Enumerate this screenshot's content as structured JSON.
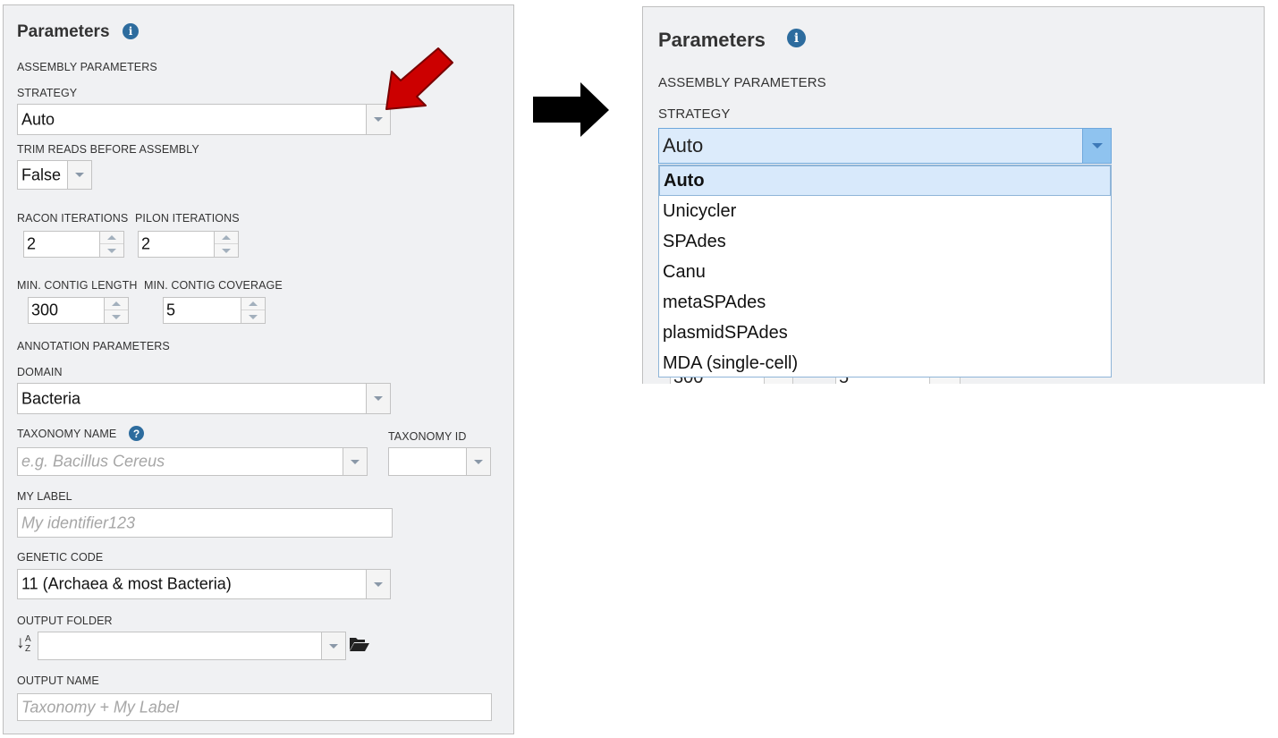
{
  "left": {
    "title": "Parameters",
    "assembly_section": "ASSEMBLY PARAMETERS",
    "strategy_label": "STRATEGY",
    "strategy_value": "Auto",
    "trim_label": "TRIM READS BEFORE ASSEMBLY",
    "trim_value": "False",
    "racon_label": "RACON ITERATIONS",
    "racon_value": "2",
    "pilon_label": "PILON ITERATIONS",
    "pilon_value": "2",
    "min_len_label": "MIN. CONTIG LENGTH",
    "min_len_value": "300",
    "min_cov_label": "MIN. CONTIG COVERAGE",
    "min_cov_value": "5",
    "annotation_section": "ANNOTATION PARAMETERS",
    "domain_label": "DOMAIN",
    "domain_value": "Bacteria",
    "taxonomy_name_label": "TAXONOMY NAME",
    "taxonomy_name_placeholder": "e.g. Bacillus Cereus",
    "taxonomy_id_label": "TAXONOMY ID",
    "my_label_label": "MY LABEL",
    "my_label_placeholder": "My identifier123",
    "genetic_code_label": "GENETIC CODE",
    "genetic_code_value": "11 (Archaea & most Bacteria)",
    "output_folder_label": "OUTPUT FOLDER",
    "output_name_label": "OUTPUT NAME",
    "output_name_placeholder": "Taxonomy + My Label",
    "sort_glyph": "↓",
    "sort_glyph_a": "A",
    "sort_glyph_z": "Z"
  },
  "right": {
    "title": "Parameters",
    "assembly_section": "ASSEMBLY PARAMETERS",
    "strategy_label": "STRATEGY",
    "strategy_value": "Auto",
    "options": [
      "Auto",
      "Unicycler",
      "SPAdes",
      "Canu",
      "metaSPAdes",
      "plasmidSPAdes",
      "MDA (single-cell)"
    ],
    "selected_option": "Auto",
    "ghost_value_1": "300",
    "ghost_value_2": "5"
  },
  "info_glyph": "i",
  "help_glyph": "?",
  "colors": {
    "panel_bg": "#f0f1f3",
    "info_blue": "#2d6c9e",
    "red_arrow": "#cc0000",
    "black_arrow": "#000000",
    "dropdown_focus": "#dcebfb",
    "dropdown_button": "#8fc3ef"
  },
  "icons": {
    "info": "info-circle-icon",
    "help": "question-circle-icon",
    "folder": "folder-open-icon",
    "sort": "sort-alpha-down-icon",
    "red_arrow": "red-pointer-arrow",
    "black_arrow": "black-right-arrow"
  }
}
